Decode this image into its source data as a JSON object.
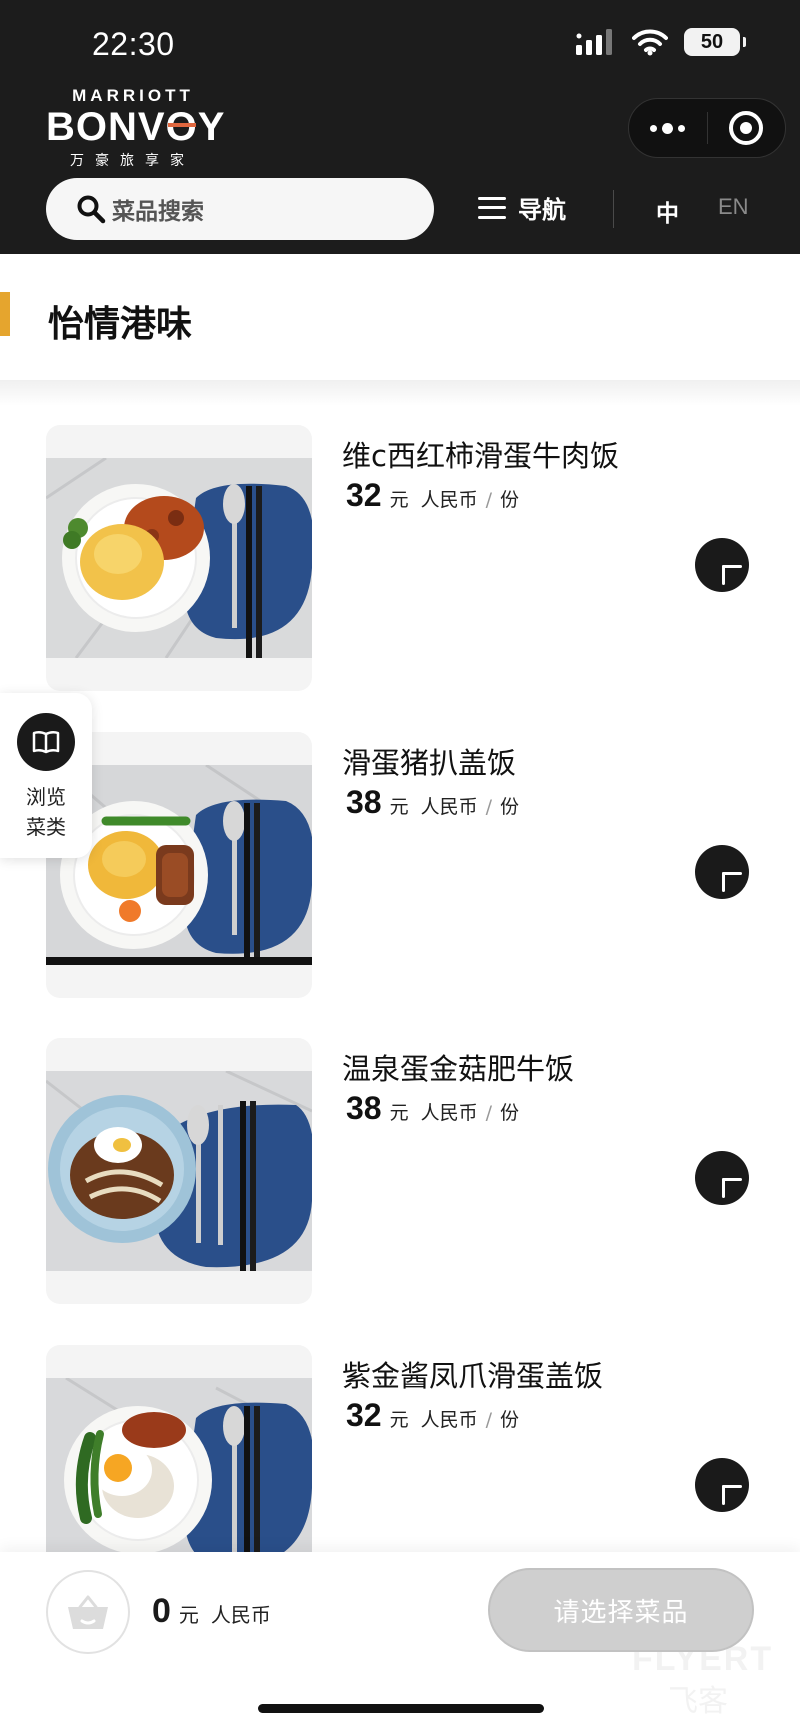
{
  "status_bar": {
    "time": "22:30",
    "battery": "50"
  },
  "brand": {
    "top": "MARRIOTT",
    "main_part1": "BONV",
    "main_accent": "O",
    "main_part2": "Y",
    "sub": "万豪旅享家"
  },
  "search": {
    "placeholder": "菜品搜索"
  },
  "nav": {
    "label": "导航"
  },
  "language": {
    "zh": "中",
    "en": "EN"
  },
  "category": {
    "title": "怡情港味"
  },
  "dishes": [
    {
      "name": "维c西红柿滑蛋牛肉饭",
      "price": "32",
      "unit": "元",
      "currency": "人民币",
      "slash": "/",
      "per": "份"
    },
    {
      "name": "滑蛋猪扒盖饭",
      "price": "38",
      "unit": "元",
      "currency": "人民币",
      "slash": "/",
      "per": "份"
    },
    {
      "name": "温泉蛋金菇肥牛饭",
      "price": "38",
      "unit": "元",
      "currency": "人民币",
      "slash": "/",
      "per": "份"
    },
    {
      "name": "紫金酱凤爪滑蛋盖饭",
      "price": "32",
      "unit": "元",
      "currency": "人民币",
      "slash": "/",
      "per": "份"
    }
  ],
  "browse": {
    "line1": "浏览",
    "line2": "菜类"
  },
  "cart": {
    "total": "0",
    "unit": "元",
    "currency": "人民币",
    "checkout_label": "请选择菜品"
  },
  "watermark": {
    "text1": "FLYERT",
    "text2": "飞客"
  },
  "colors": {
    "header_bg": "#1c1c1c",
    "category_accent": "#e5a52e",
    "logo_accent": "#e0673f",
    "placemat": "#2a4f8a"
  },
  "icons": [
    "search-icon",
    "menu-icon",
    "more-dots-icon",
    "target-icon",
    "book-icon",
    "plus-icon",
    "basket-icon",
    "wifi-icon",
    "signal-icon"
  ]
}
